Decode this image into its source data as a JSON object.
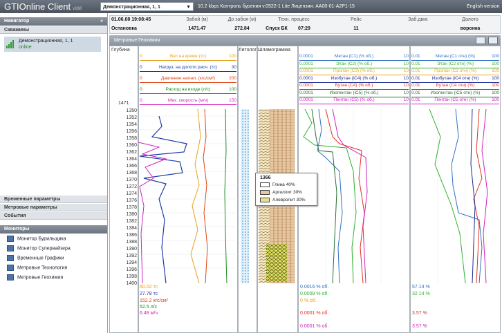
{
  "topbar": {
    "app_title": "GTIOnline Client",
    "app_version": "v168",
    "well_select_value": "Демонстрационная, 1, 1",
    "status_text": "10.2 kbps   Контроль бурения v.0522-1 Lite   Лицензия: AA00-01-A2P1-15",
    "language": "English version"
  },
  "left_panel": {
    "navigator_title": "Навигатор",
    "wells_title": "Скважины",
    "well_name": "Демонстрационная, 1, 1",
    "well_status": "online",
    "sections": [
      "Временные параметры",
      "Метровые параметры",
      "События"
    ],
    "monitors_title": "Мониторы",
    "monitors": [
      "Монитор Бурильщика",
      "Монитор Супервайзера",
      "Временные Графики",
      "Метровые Технология",
      "Метровые Геохимия"
    ]
  },
  "info_table": {
    "date": "01.06.08 19:08:45",
    "state": "Остановка",
    "headers": [
      "Забой (м)",
      "До забоя (м)",
      "Техн. процесс",
      "Рейс",
      "Заб.двиг.",
      "Долото"
    ],
    "values": [
      "1471.47",
      "272.84",
      "Спуск БК",
      "07:29",
      "11",
      "",
      "воронка"
    ]
  },
  "panel": {
    "title": "Метровые Геохимия"
  },
  "track_headers": {
    "depth": "Глубина",
    "litho": "Литолог",
    "shlam": "Шламограмма"
  },
  "depth_current": "1471",
  "drill_legend": [
    {
      "label": "Вес на крюке (тс)",
      "min": "0",
      "max": "100",
      "color": "#e8a020"
    },
    {
      "label": "Нагруз. на долото расч. (тс)",
      "min": "0",
      "max": "30",
      "color": "#1a3aa8"
    },
    {
      "label": "Давление нагнет. (кгс/см²)",
      "min": "0",
      "max": "200",
      "color": "#e04010"
    },
    {
      "label": "Расход на входе (л/с)",
      "min": "0",
      "max": "100",
      "color": "#1a8a1a"
    },
    {
      "label": "Мех. скорость (м/ч)",
      "min": "0",
      "max": "150",
      "color": "#d020c0"
    }
  ],
  "gas_legend": [
    {
      "label": "Метан (C1) (% об.)",
      "min": "0.0001",
      "max": "10",
      "color": "#3070c0"
    },
    {
      "label": "Этан (C2) (% об.)",
      "min": "0.0001",
      "max": "10",
      "color": "#30b030"
    },
    {
      "label": "Пропан (C3) (% об.)",
      "min": "0.0001",
      "max": "10",
      "color": "#f0a020"
    },
    {
      "label": "Изобутан (iC4) (% об.)",
      "min": "0.0001",
      "max": "10",
      "color": "#1a2a90"
    },
    {
      "label": "Бутан (C4) (% об.)",
      "min": "0.0001",
      "max": "10",
      "color": "#e03020"
    },
    {
      "label": "Изопентан (iC5) (% об.)",
      "min": "0.0001",
      "max": "10",
      "color": "#207030"
    },
    {
      "label": "Пентан (C5) (% об.)",
      "min": "0.0001",
      "max": "10",
      "color": "#d020c0"
    }
  ],
  "rel_legend": [
    {
      "label": "Метан (C1 отн) (%)",
      "min": "0.01",
      "max": "100",
      "color": "#3070c0"
    },
    {
      "label": "Этан (C2 отн) (%)",
      "min": "0.01",
      "max": "100",
      "color": "#30b030"
    },
    {
      "label": "Пропан (C3 отн) (%)",
      "min": "0.01",
      "max": "100",
      "color": "#f0a020"
    },
    {
      "label": "Изобутан (iC4 отн) (%)",
      "min": "0.01",
      "max": "100",
      "color": "#1a2a90"
    },
    {
      "label": "Бутан (C4 отн) (%)",
      "min": "0.01",
      "max": "100",
      "color": "#e03020"
    },
    {
      "label": "Изопентан (iC5 отн) (%)",
      "min": "0.01",
      "max": "100",
      "color": "#207030"
    },
    {
      "label": "Пентан (C5 отн) (%)",
      "min": "0.01",
      "max": "100",
      "color": "#d020c0"
    }
  ],
  "depth_ticks": [
    "1350",
    "1352",
    "1354",
    "1356",
    "1358",
    "1360",
    "1362",
    "1364",
    "1366",
    "1368",
    "1370",
    "1372",
    "1374",
    "1376",
    "1378",
    "1380",
    "1382",
    "1384",
    "1386",
    "1388",
    "1390",
    "1392",
    "1394",
    "1396",
    "1398",
    "1400"
  ],
  "popup": {
    "depth": "1366",
    "items": [
      {
        "label": "Глина 40%",
        "color": "#ffffff"
      },
      {
        "label": "Аргиллит 30%",
        "color": "#e8c8a0"
      },
      {
        "label": "Алевролит 30%",
        "color": "#e8e090"
      }
    ]
  },
  "bottom_values": {
    "drill": [
      {
        "text": "60.02 тс",
        "color": "#e8a020"
      },
      {
        "text": "27.78 тс",
        "color": "#1a3aa8"
      },
      {
        "text": "152.2 кгс/см²",
        "color": "#e04010"
      },
      {
        "text": "52.5 л/с",
        "color": "#1a8a1a"
      },
      {
        "text": "6.48 м/ч",
        "color": "#d020c0"
      }
    ],
    "gas": [
      {
        "text": "0.0016 % об.",
        "color": "#3070c0"
      },
      {
        "text": "0.0009 % об.",
        "color": "#30b030"
      },
      {
        "text": "0 % об.",
        "color": "#f0a020"
      },
      {
        "text": "0.0001 % об.",
        "color": "#e03020"
      },
      {
        "text": "0.0001 % об.",
        "color": "#d020c0"
      }
    ],
    "rel": [
      {
        "text": "57.14 %",
        "color": "#3070c0"
      },
      {
        "text": "32.14 %",
        "color": "#30b030"
      },
      {
        "text": "3.57 %",
        "color": "#e03020"
      },
      {
        "text": "3.57 %",
        "color": "#d020c0"
      }
    ]
  }
}
